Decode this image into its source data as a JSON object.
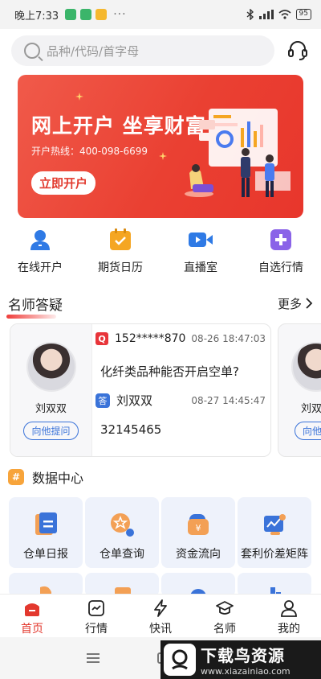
{
  "status_bar": {
    "time": "晚上7:33",
    "dots": "···",
    "battery": "95"
  },
  "search": {
    "placeholder": "品种/代码/首字母"
  },
  "banner": {
    "title": "网上开户 坐享财富",
    "phone": "开户热线：400-098-6699",
    "button": "立即开户"
  },
  "quick_nav": [
    {
      "label": "在线开户",
      "icon": "user-add-icon",
      "color": "#2f7ae5"
    },
    {
      "label": "期货日历",
      "icon": "calendar-icon",
      "color": "#f5a623"
    },
    {
      "label": "直播室",
      "icon": "video-icon",
      "color": "#2f7ae5"
    },
    {
      "label": "自选行情",
      "icon": "plus-icon",
      "color": "#8a63e8"
    }
  ],
  "qa_section": {
    "title": "名师答疑",
    "more": "更多"
  },
  "qa_card": {
    "teacher": "刘双双",
    "ask_button": "向他提问",
    "question_tag": "Q",
    "question_user": "152*****870",
    "question_time": "08-26 18:47:03",
    "question": "化纤类品种能否开启空单?",
    "answer_tag": "答",
    "answer_name": "刘双双",
    "answer_time": "08-27 14:45:47",
    "answer": "32145465"
  },
  "qa_card2": {
    "teacher": "刘双",
    "ask_button": "向他"
  },
  "data_center": {
    "icon_text": "#",
    "title": "数据中心",
    "tiles": [
      {
        "label": "仓单日报",
        "icon": "report-icon"
      },
      {
        "label": "仓单查询",
        "icon": "query-icon"
      },
      {
        "label": "资金流向",
        "icon": "money-flow-icon"
      },
      {
        "label": "套利价差矩阵",
        "icon": "matrix-chart-icon"
      }
    ]
  },
  "tabs": [
    {
      "label": "首页",
      "active": true
    },
    {
      "label": "行情",
      "active": false
    },
    {
      "label": "快讯",
      "active": false
    },
    {
      "label": "名师",
      "active": false
    },
    {
      "label": "我的",
      "active": false
    }
  ],
  "watermark": {
    "title": "下载鸟资源",
    "url": "www.xiazainiao.com"
  },
  "colors": {
    "accent_red": "#e3382e",
    "accent_blue": "#3a73d9"
  }
}
